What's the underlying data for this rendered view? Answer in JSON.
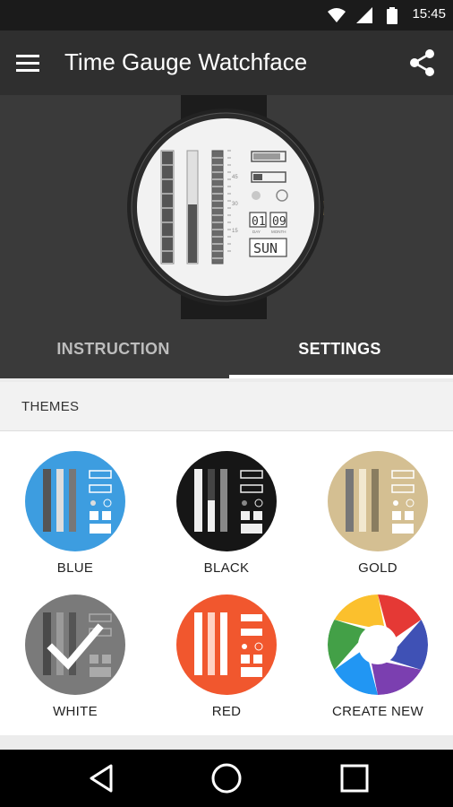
{
  "status_bar": {
    "time": "15:45",
    "icons": [
      "wifi-icon",
      "cell-signal-icon",
      "battery-icon"
    ]
  },
  "app_bar": {
    "title": "Time Gauge Watchface",
    "menu_icon": "menu-icon",
    "share_icon": "share-icon"
  },
  "preview": {
    "scale_labels": [
      "45",
      "30",
      "15"
    ],
    "day": "01",
    "month": "09",
    "day_label": "DAY",
    "month_label": "MONTH",
    "weekday": "SUN"
  },
  "tabs": [
    {
      "label": "INSTRUCTION",
      "active": false
    },
    {
      "label": "SETTINGS",
      "active": true
    }
  ],
  "section": {
    "title": "THEMES"
  },
  "themes": [
    {
      "label": "BLUE",
      "color": "#3d9de0",
      "selected": false
    },
    {
      "label": "BLACK",
      "color": "#161616",
      "selected": false
    },
    {
      "label": "GOLD",
      "color": "#d4bf92",
      "selected": false
    },
    {
      "label": "WHITE",
      "color": "#7a7a7a",
      "selected": true
    },
    {
      "label": "RED",
      "color": "#f1572e",
      "selected": false
    },
    {
      "label": "CREATE NEW",
      "color": "#ffffff",
      "selected": false
    }
  ],
  "nav_bar": {
    "icons": [
      "back-icon",
      "home-icon",
      "recents-icon"
    ]
  }
}
